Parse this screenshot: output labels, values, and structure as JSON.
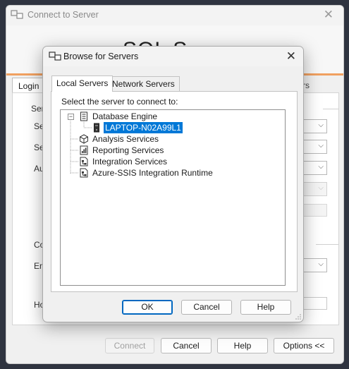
{
  "background_window": {
    "title": "Connect to Server",
    "banner_text": "SQL S",
    "tabs": [
      "Login",
      "rs"
    ],
    "labels": [
      "Ser",
      "Ser",
      "Ser",
      "Aut",
      "Con",
      "Enc",
      "Ho"
    ],
    "buttons": {
      "connect": "Connect",
      "cancel": "Cancel",
      "help": "Help",
      "options": "Options <<"
    }
  },
  "dialog": {
    "title": "Browse for Servers",
    "tabs": {
      "local": "Local Servers",
      "network": "Network Servers"
    },
    "instruction": "Select the server to connect to:",
    "tree": {
      "database_engine": "Database Engine",
      "server_instance": "LAPTOP-N02A99L1",
      "analysis_services": "Analysis Services",
      "reporting_services": "Reporting Services",
      "integration_services": "Integration Services",
      "azure_ssis": "Azure-SSIS Integration Runtime"
    },
    "buttons": {
      "ok": "OK",
      "cancel": "Cancel",
      "help": "Help"
    }
  },
  "colors": {
    "accent": "#0078d7",
    "banner_stripe": "#f0a060"
  },
  "icons": [
    "server-window-icon",
    "close-icon",
    "database-engine-icon",
    "server-icon",
    "cube-icon",
    "report-icon",
    "integration-icon"
  ]
}
